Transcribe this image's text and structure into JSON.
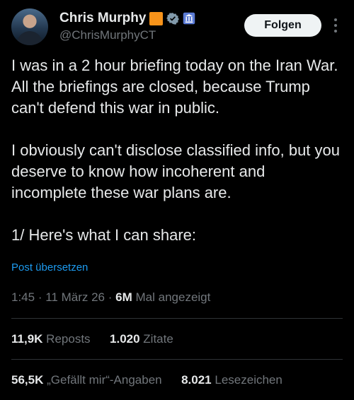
{
  "author": {
    "name": "Chris Murphy",
    "handle": "@ChrisMurphyCT",
    "follow_label": "Folgen",
    "flag_color": "#f7931a"
  },
  "tweet": {
    "paragraphs": [
      "I was in a 2 hour briefing today on the Iran War. All the briefings are closed, because Trump can't defend this war in public.",
      "I obviously can't disclose classified info, but you deserve to know how incoherent and incomplete these war plans are.",
      "1/ Here's what I can share:"
    ],
    "translate_label": "Post übersetzen"
  },
  "meta": {
    "time": "1:45",
    "sep": "·",
    "date": "11 März 26",
    "views_count": "6M",
    "views_label": "Mal angezeigt"
  },
  "stats": {
    "reposts_count": "11,9K",
    "reposts_label": "Reposts",
    "quotes_count": "1.020",
    "quotes_label": "Zitate",
    "likes_count": "56,5K",
    "likes_label": "„Gefällt mir“-Angaben",
    "bookmarks_count": "8.021",
    "bookmarks_label": "Lesezeichen"
  },
  "colors": {
    "background": "#000000",
    "text": "#e7e9ea",
    "secondary": "#71767b",
    "link": "#1d9bf0",
    "verified": "#1d9bf0"
  }
}
